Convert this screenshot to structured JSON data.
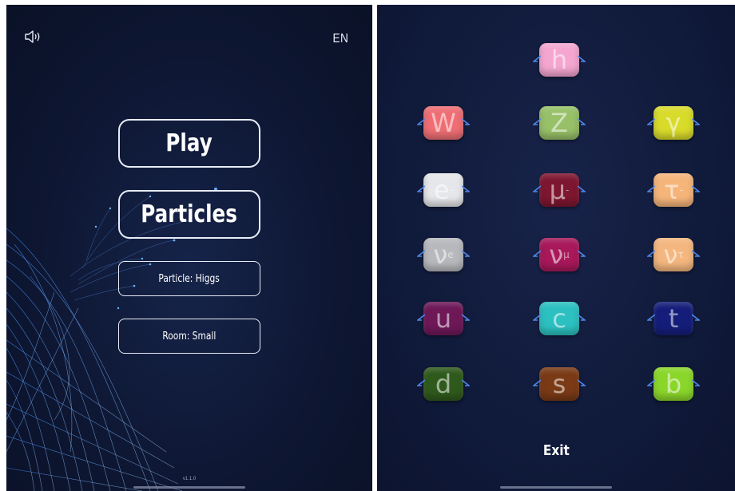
{
  "menu": {
    "language": "EN",
    "play_label": "Play",
    "particles_label": "Particles",
    "particle_setting": "Particle: Higgs",
    "room_setting": "Room: Small",
    "version": "v1.1.0",
    "icons": {
      "sound": "speaker-icon"
    }
  },
  "particles": {
    "exit_label": "Exit",
    "items": [
      {
        "symbol": "h",
        "color": "#f4a6d0"
      },
      {
        "symbol": "W",
        "color": "#ee6e74"
      },
      {
        "symbol": "Z",
        "color": "#97c068"
      },
      {
        "symbol": "γ",
        "color": "#d8db2a"
      },
      {
        "symbol": "e",
        "sup": "-",
        "color": "#e6e7ea"
      },
      {
        "symbol": "μ",
        "sup": "-",
        "color": "#7e1630"
      },
      {
        "symbol": "τ",
        "sup": "-",
        "color": "#f5b57a"
      },
      {
        "symbol": "ν",
        "sub": "e",
        "color": "#b8b9bd"
      },
      {
        "symbol": "ν",
        "sub": "μ",
        "color": "#a8185a"
      },
      {
        "symbol": "ν",
        "sub": "τ",
        "color": "#f4b77f"
      },
      {
        "symbol": "u",
        "color": "#6e1858"
      },
      {
        "symbol": "c",
        "color": "#2cc0c0"
      },
      {
        "symbol": "t",
        "color": "#141e7a"
      },
      {
        "symbol": "d",
        "color": "#2f5a1c"
      },
      {
        "symbol": "s",
        "color": "#7a3a16"
      },
      {
        "symbol": "b",
        "color": "#8ad62a"
      }
    ]
  },
  "colors": {
    "background": "#0e1733",
    "wing": "#4e86e8"
  }
}
